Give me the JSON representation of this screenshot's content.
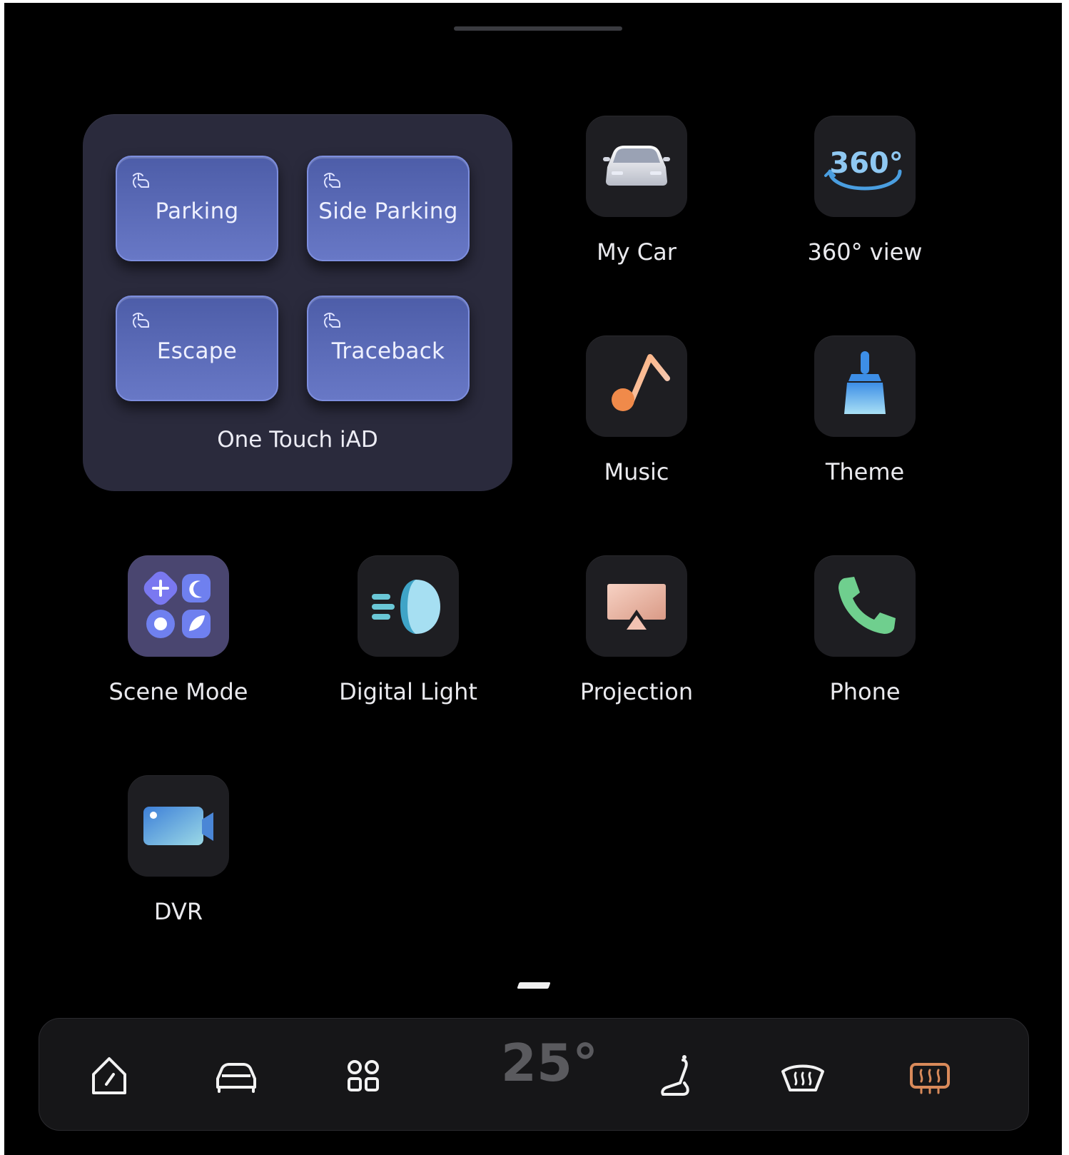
{
  "widget": {
    "title": "One Touch iAD",
    "buttons": [
      {
        "label": "Parking",
        "icon": "hand-touch-icon"
      },
      {
        "label": "Side Parking",
        "icon": "hand-touch-icon"
      },
      {
        "label": "Escape",
        "icon": "hand-touch-icon"
      },
      {
        "label": "Traceback",
        "icon": "hand-touch-icon"
      }
    ]
  },
  "apps": [
    {
      "label": "My Car",
      "icon": "car-icon"
    },
    {
      "label": "360° view",
      "icon": "360-view-icon",
      "icon_text": "360°"
    },
    {
      "label": "Music",
      "icon": "music-note-icon"
    },
    {
      "label": "Theme",
      "icon": "paint-brush-icon"
    },
    {
      "label": "Scene Mode",
      "icon": "scene-mode-icon"
    },
    {
      "label": "Digital Light",
      "icon": "headlight-icon"
    },
    {
      "label": "Projection",
      "icon": "screen-cast-icon"
    },
    {
      "label": "Phone",
      "icon": "phone-icon"
    },
    {
      "label": "DVR",
      "icon": "video-camera-icon"
    }
  ],
  "dock": {
    "temperature": "25°",
    "items": [
      {
        "icon": "home-icon"
      },
      {
        "icon": "car-icon"
      },
      {
        "icon": "apps-grid-icon"
      },
      {
        "icon": "seat-icon"
      },
      {
        "icon": "front-defrost-icon"
      },
      {
        "icon": "rear-defrost-icon",
        "active": true
      }
    ],
    "active_color": "#d98a5a"
  },
  "colors": {
    "background": "#000000",
    "widget": "#2a2a3c",
    "widget_button": "#5a6ab6",
    "tile": "#1e1e22"
  }
}
